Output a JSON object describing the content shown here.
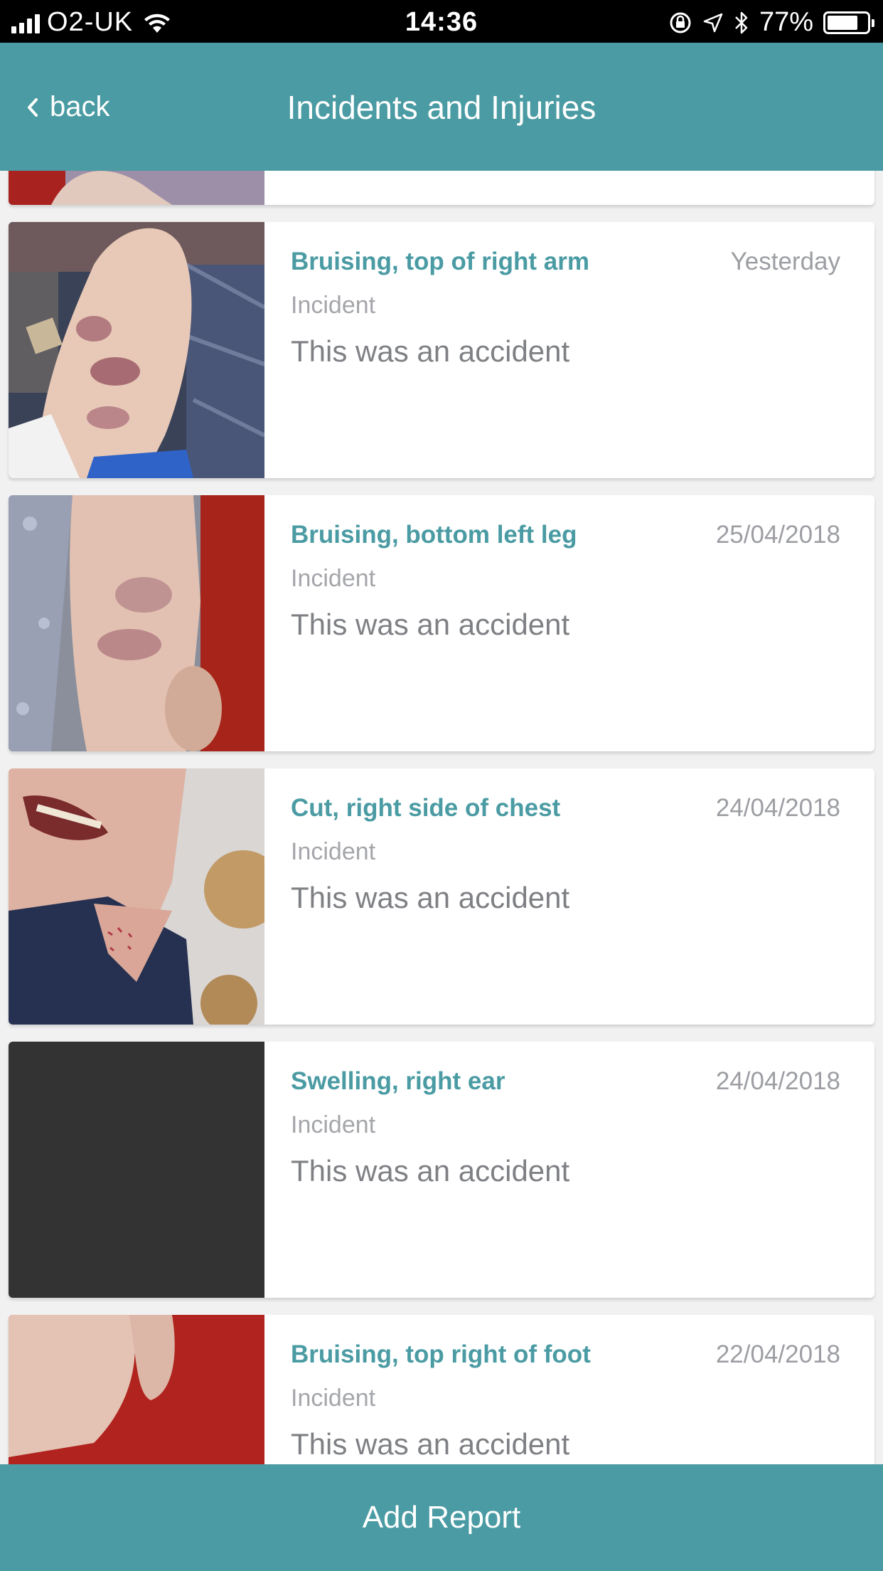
{
  "status_bar": {
    "carrier": "O2-UK",
    "time": "14:36",
    "battery_percent": "77%",
    "battery_level": 0.77,
    "icons": [
      "signal-icon",
      "wifi-icon",
      "rotation-lock-icon",
      "location-icon",
      "bluetooth-icon",
      "battery-icon"
    ]
  },
  "nav": {
    "back_label": "back",
    "title": "Incidents and Injuries"
  },
  "incidents": [
    {
      "title": "Bruising, top of right arm",
      "date": "Yesterday",
      "type": "Incident",
      "description": "This was an accident",
      "thumbnail": "photo-arm-bruise"
    },
    {
      "title": "Bruising, bottom left leg",
      "date": "25/04/2018",
      "type": "Incident",
      "description": "This was an accident",
      "thumbnail": "photo-leg-bruise"
    },
    {
      "title": "Cut, right side of chest",
      "date": "24/04/2018",
      "type": "Incident",
      "description": "This was an accident",
      "thumbnail": "photo-chest-cut"
    },
    {
      "title": "Swelling, right ear",
      "date": "24/04/2018",
      "type": "Incident",
      "description": "This was an accident",
      "thumbnail": "photo-placeholder-dark"
    },
    {
      "title": "Bruising, top right of foot",
      "date": "22/04/2018",
      "type": "Incident",
      "description": "This was an accident",
      "thumbnail": "photo-foot-bruise"
    }
  ],
  "footer": {
    "add_report_label": "Add Report"
  },
  "colors": {
    "accent": "#4a9ba3",
    "status_bar_bg": "#000000",
    "background": "#f1f1f2"
  }
}
